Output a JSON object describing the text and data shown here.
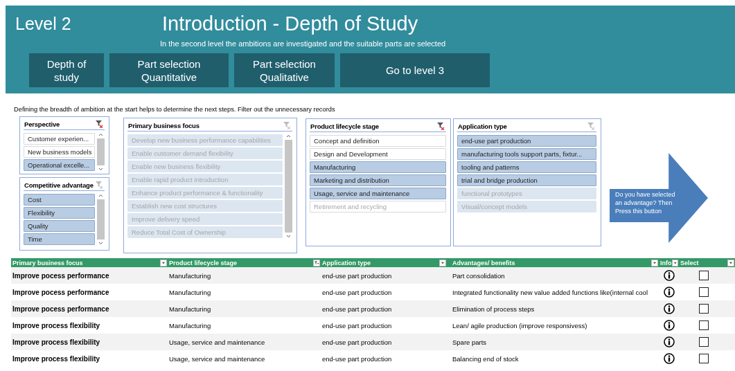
{
  "header": {
    "level": "Level 2",
    "title": "Introduction - Depth of Study",
    "subtitle": "In the second level the ambitions are investigated and the suitable parts are selected",
    "buttons": [
      "Depth of study",
      "Part selection Quantitative",
      "Part selection Qualitative",
      "Go to level 3"
    ]
  },
  "instruction": "Defining the breadth of ambition at the start helps to determine the next steps. Filter out the unnecessary  records",
  "slicers": [
    {
      "title": "Perspective",
      "filtered": true,
      "items": [
        {
          "label": "Customer experien...",
          "selected": false,
          "disabled": false
        },
        {
          "label": "New business models",
          "selected": false,
          "disabled": false
        },
        {
          "label": "Operational excelle...",
          "selected": true,
          "disabled": false
        }
      ]
    },
    {
      "title": "Competitive advantage",
      "filtered": false,
      "items": [
        {
          "label": "Cost",
          "selected": true,
          "disabled": false
        },
        {
          "label": "Flexibility",
          "selected": true,
          "disabled": false
        },
        {
          "label": "Quality",
          "selected": true,
          "disabled": false
        },
        {
          "label": "Time",
          "selected": true,
          "disabled": false
        }
      ]
    },
    {
      "title": "Primary business focus",
      "filtered": false,
      "items": [
        {
          "label": "Develop new business performance capabilities",
          "selected": true,
          "disabled": true
        },
        {
          "label": "Enable customer demand flexibility",
          "selected": true,
          "disabled": true
        },
        {
          "label": "Enable new business flexibility",
          "selected": true,
          "disabled": true
        },
        {
          "label": "Enable rapid product introduction",
          "selected": true,
          "disabled": true
        },
        {
          "label": "Enhance product performance & functionality",
          "selected": true,
          "disabled": true
        },
        {
          "label": "Establish new cost structures",
          "selected": true,
          "disabled": true
        },
        {
          "label": "Improve delivery speed",
          "selected": true,
          "disabled": true
        },
        {
          "label": "Reduce Total Cost of Ownership",
          "selected": true,
          "disabled": true
        }
      ]
    },
    {
      "title": "Product lifecycle stage",
      "filtered": true,
      "items": [
        {
          "label": "Concept and definition",
          "selected": false,
          "disabled": false
        },
        {
          "label": "Design and Development",
          "selected": false,
          "disabled": false
        },
        {
          "label": "Manufacturing",
          "selected": true,
          "disabled": false
        },
        {
          "label": "Marketing and distribution",
          "selected": true,
          "disabled": false
        },
        {
          "label": "Usage, service and maintenance",
          "selected": true,
          "disabled": false
        },
        {
          "label": "Retirement and recycling",
          "selected": false,
          "disabled": true
        }
      ]
    },
    {
      "title": "Application type",
      "filtered": false,
      "items": [
        {
          "label": "end-use part production",
          "selected": true,
          "disabled": false
        },
        {
          "label": "manufacturing tools support parts, fixtur...",
          "selected": true,
          "disabled": false
        },
        {
          "label": "tooling and patterns",
          "selected": true,
          "disabled": false
        },
        {
          "label": "trial and bridge production",
          "selected": true,
          "disabled": false
        },
        {
          "label": "functional prototypes",
          "selected": true,
          "disabled": true
        },
        {
          "label": "Visual/concept models",
          "selected": true,
          "disabled": true
        }
      ]
    }
  ],
  "arrow_button": "Do you have selected an advantage?  Then Press this button",
  "table": {
    "columns": [
      {
        "label": "Primary business focus",
        "filtered": false
      },
      {
        "label": "Product lifecycle stage",
        "filtered": true
      },
      {
        "label": "Application type",
        "filtered": false
      },
      {
        "label": "Advantages/ benefits",
        "filtered": false
      },
      {
        "label": "Info",
        "filtered": false
      },
      {
        "label": "Select",
        "filtered": false
      }
    ],
    "rows": [
      {
        "focus": "Improve pocess performance",
        "stage": "Manufacturing",
        "application": "end-use part production",
        "advantage": "Part consolidation",
        "checked": false
      },
      {
        "focus": "Improve pocess performance",
        "stage": "Manufacturing",
        "application": "end-use part production",
        "advantage": " Integrated functionality new value added functions like(internal cool",
        "checked": false
      },
      {
        "focus": "Improve pocess performance",
        "stage": "Manufacturing",
        "application": "end-use part production",
        "advantage": "Elimination of process steps",
        "checked": false
      },
      {
        "focus": "Improve process flexibility",
        "stage": "Manufacturing",
        "application": "end-use part production",
        "advantage": "Lean/ agile production (improve responsivess)",
        "checked": false
      },
      {
        "focus": "Improve process flexibility",
        "stage": "Usage, service and maintenance",
        "application": "end-use part production",
        "advantage": "Spare parts",
        "checked": false
      },
      {
        "focus": "Improve process flexibility",
        "stage": "Usage, service and maintenance",
        "application": "end-use part production",
        "advantage": "Balancing end of stock",
        "checked": false
      }
    ]
  }
}
